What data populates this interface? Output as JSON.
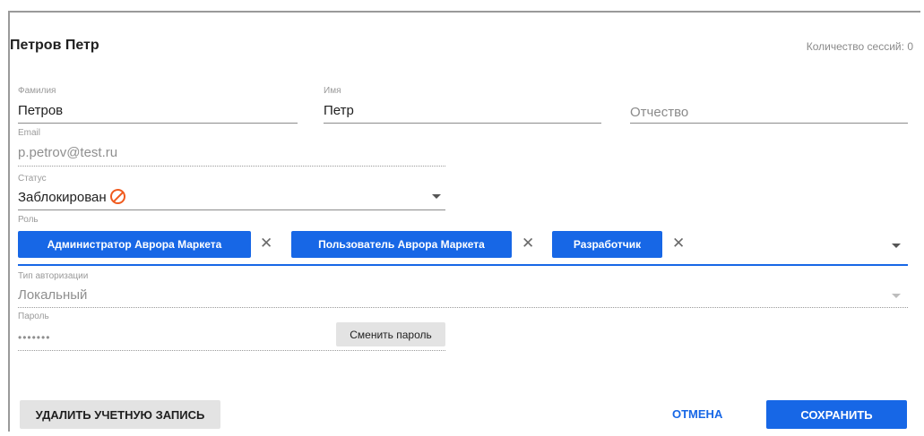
{
  "user": {
    "title": "Петров Петр"
  },
  "sessions": {
    "label": "Количество сессий:",
    "count": "0"
  },
  "fields": {
    "last_name": {
      "label": "Фамилия",
      "value": "Петров"
    },
    "first_name": {
      "label": "Имя",
      "value": "Петр"
    },
    "middle_name": {
      "placeholder": "Отчество"
    },
    "email": {
      "label": "Email",
      "value": "p.petrov@test.ru"
    },
    "status": {
      "label": "Статус",
      "value": "Заблокирован"
    },
    "role": {
      "label": "Роль",
      "chips": [
        "Администратор Аврора Маркета",
        "Пользователь Аврора Маркета",
        "Разработчик"
      ]
    },
    "auth_type": {
      "label": "Тип авторизации",
      "value": "Локальный"
    },
    "password": {
      "label": "Пароль",
      "value": "•••••••",
      "change_label": "Сменить пароль"
    }
  },
  "actions": {
    "delete_label": "УДАЛИТЬ УЧЕТНУЮ ЗАПИСЬ",
    "cancel_label": "ОТМЕНА",
    "save_label": "СОХРАНИТЬ"
  },
  "colors": {
    "accent": "#1767e6",
    "blocked_icon": "#f05a1e"
  },
  "icons": {
    "status": "block-icon",
    "remove": "close-icon",
    "dropdown": "chevron-down-icon"
  }
}
